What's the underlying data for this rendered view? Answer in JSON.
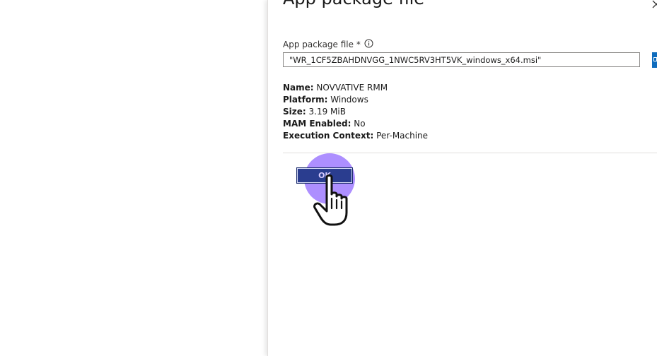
{
  "panel": {
    "title": "App package file",
    "close_icon": "close-icon"
  },
  "field": {
    "label": "App package file *",
    "info_icon": "info-icon",
    "value": "\"WR_1CF5ZBAHDNVGG_1NWC5RV3HT5VK_windows_x64.msi\"",
    "browse_icon": "folder-icon"
  },
  "details": [
    {
      "key": "Name:",
      "value": "NOVVATIVE RMM"
    },
    {
      "key": "Platform:",
      "value": "Windows"
    },
    {
      "key": "Size:",
      "value": "3.19 MiB"
    },
    {
      "key": "MAM Enabled:",
      "value": "No"
    },
    {
      "key": "Execution Context:",
      "value": "Per-Machine"
    }
  ],
  "actions": {
    "ok_label": "OK"
  },
  "cursor": {
    "icon": "hand-pointer-icon"
  },
  "colors": {
    "accent": "#0f6cbd",
    "ok_button": "#2a3d8f",
    "click_halo": "#9670ff"
  }
}
